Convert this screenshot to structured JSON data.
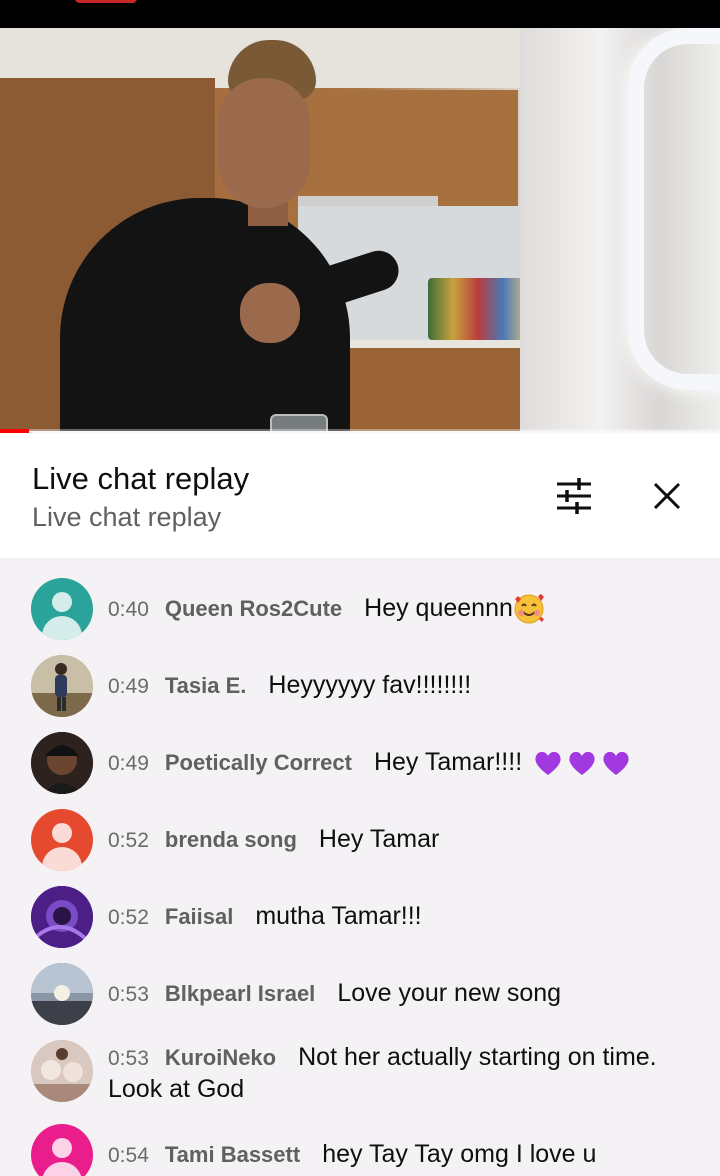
{
  "video": {
    "progress_fraction": 0.04,
    "accent_color": "#ff0000"
  },
  "chat_header": {
    "title": "Live chat replay",
    "subtitle": "Live chat replay",
    "filter_icon": "tune-icon",
    "close_icon": "close-icon"
  },
  "messages": [
    {
      "time": "0:40",
      "author": "Queen Ros2Cute",
      "text": "Hey queennn",
      "emoji": "smiling-face-with-hearts",
      "avatar_color": "#2aa39a",
      "avatar_type": "silhouette"
    },
    {
      "time": "0:49",
      "author": "Tasia E.",
      "text": "Heyyyyyy fav!!!!!!!!",
      "avatar_color": "#b6a88a",
      "avatar_type": "photo"
    },
    {
      "time": "0:49",
      "author": "Poetically Correct",
      "text": "Hey Tamar!!!! ",
      "emoji": "purple-heart x3",
      "avatar_color": "#3a2a24",
      "avatar_type": "photo"
    },
    {
      "time": "0:52",
      "author": "brenda song",
      "text": "Hey Tamar",
      "avatar_color": "#e64a2e",
      "avatar_type": "silhouette"
    },
    {
      "time": "0:52",
      "author": "Faiisal",
      "text": "mutha Tamar!!!",
      "avatar_color": "#5a2a9a",
      "avatar_type": "photo"
    },
    {
      "time": "0:53",
      "author": "Blkpearl Israel",
      "text": "Love your new song",
      "avatar_color": "#7e8896",
      "avatar_type": "photo"
    },
    {
      "time": "0:53",
      "author": "KuroiNeko",
      "text": "Not her actually starting on time. Look at God",
      "avatar_color": "#c9b2a8",
      "avatar_type": "photo"
    },
    {
      "time": "0:54",
      "author": "Tami Bassett",
      "text": "hey Tay Tay omg I love u",
      "avatar_color": "#e91e8c",
      "avatar_type": "silhouette"
    }
  ]
}
